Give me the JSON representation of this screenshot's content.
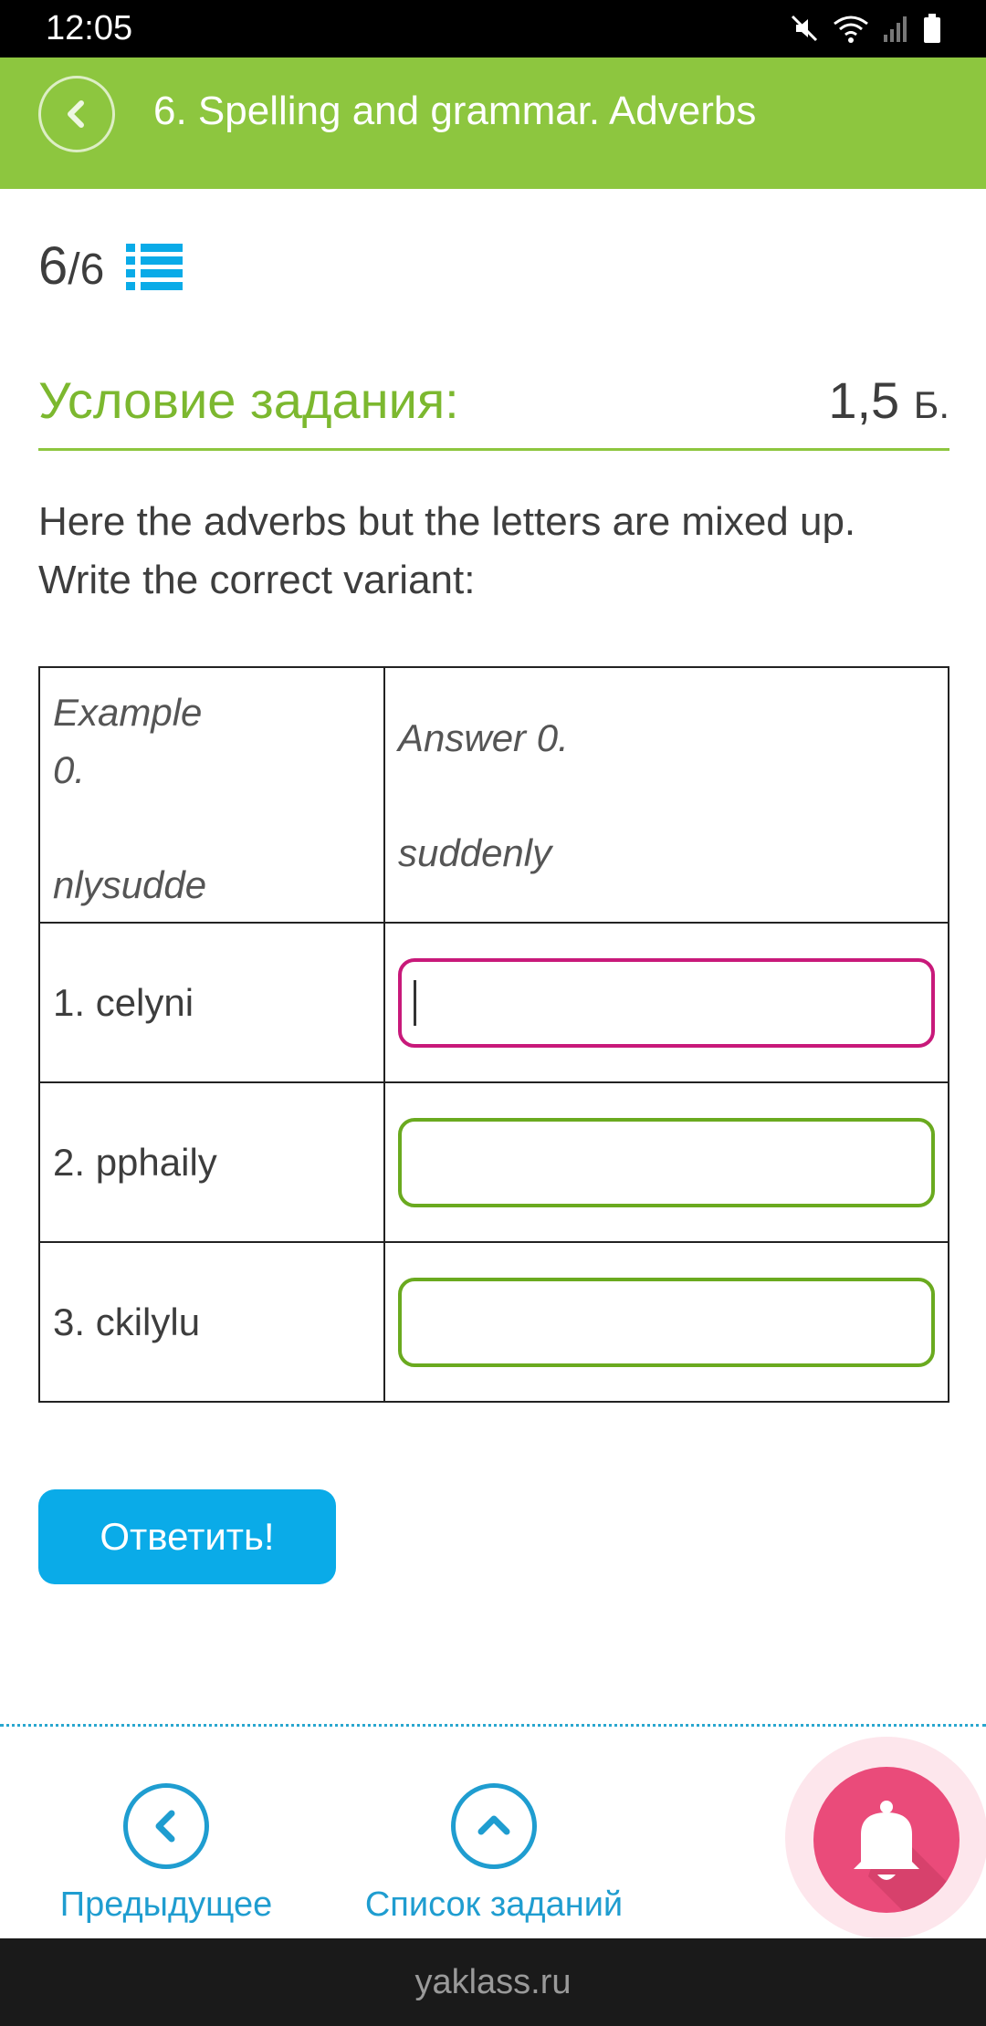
{
  "status_bar": {
    "time": "12:05"
  },
  "header": {
    "title": "6. Spelling and grammar. Adverbs"
  },
  "progress": {
    "current": "6",
    "separator_total": "/6"
  },
  "condition": {
    "title": "Условие задания:",
    "points": "1,5",
    "points_unit": "Б."
  },
  "task": {
    "text": "Here the adverbs but the letters are mixed up. Write the correct variant:"
  },
  "table": {
    "example": {
      "left_line1": "Example",
      "left_line2": "0.",
      "left_line3": "nlysudde",
      "right_line1": "Answer 0.",
      "right_line2": "suddenly"
    },
    "rows": [
      {
        "prompt": "1. celyni",
        "value": "",
        "placeholder": ""
      },
      {
        "prompt": "2. pphaily",
        "value": "",
        "placeholder": ""
      },
      {
        "prompt": "3. ckilylu",
        "value": "",
        "placeholder": ""
      }
    ]
  },
  "submit": {
    "label": "Ответить!"
  },
  "nav": {
    "prev_label": "Предыдущее",
    "list_label": "Список заданий"
  },
  "footer": {
    "site": "yaklass.ru"
  },
  "colors": {
    "green": "#8dc63f",
    "blue": "#0aabe8",
    "pink": "#ea4b7a",
    "active_border": "#c8197a"
  },
  "icons": [
    "back-icon",
    "list-icon",
    "chevron-left-icon",
    "chevron-up-icon",
    "bell-icon",
    "mute-icon",
    "wifi-icon",
    "signal-icon",
    "battery-icon"
  ]
}
